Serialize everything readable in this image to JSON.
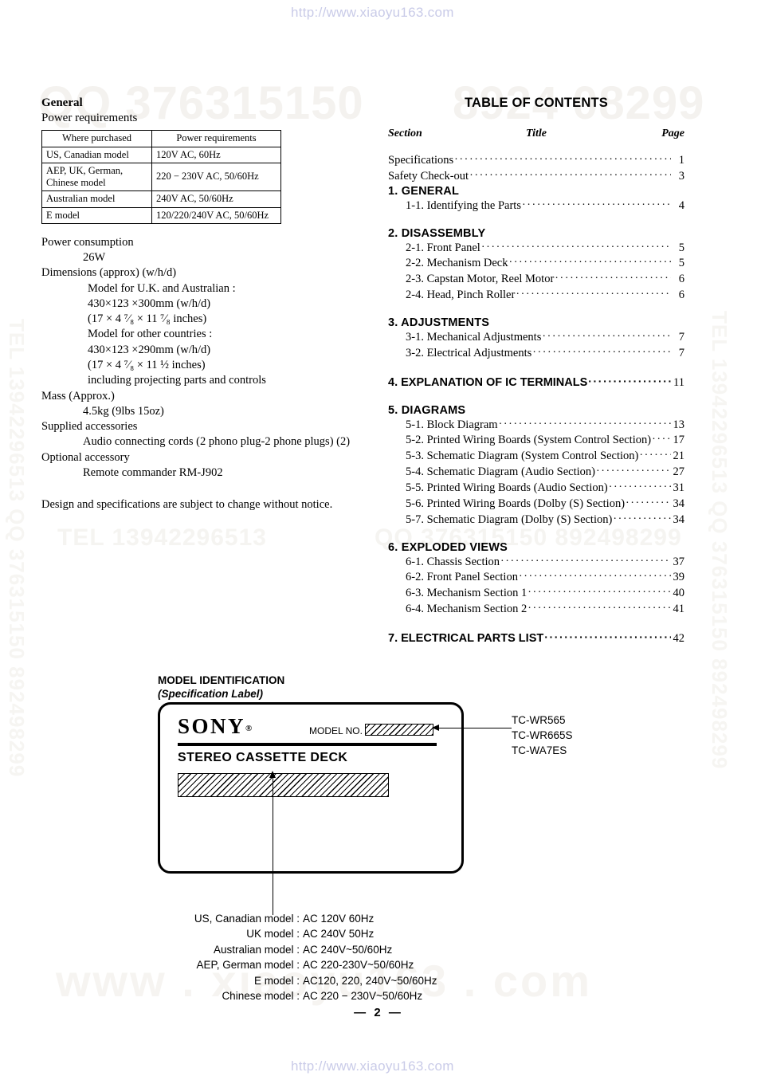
{
  "watermarks": {
    "top_url": "http://www.xiaoyu163.com",
    "bottom_url": "http://www.xiaoyu163.com",
    "qq_big": "QQ 376315150",
    "qq_big2": "8924 08299",
    "tel_mid": "TEL  13942296513",
    "qq_mid": "QQ 376315150   892498299",
    "vert_left": "TEL 13942296513 QQ 376315150 892498299",
    "vert_right": "TEL 13942296513 QQ 376315150 892498299",
    "site_big": "www . xiaoyu163 . com",
    "color_url": "#c9cbe8",
    "color_mark": "#f5f3f0"
  },
  "specifications": {
    "heading": "General",
    "subheading": "Power requirements",
    "table": {
      "headers": [
        "Where purchased",
        "Power requirements"
      ],
      "rows": [
        [
          "US, Canadian model",
          "120V AC, 60Hz"
        ],
        [
          "AEP, UK, German,\nChinese model",
          "220 − 230V AC, 50/60Hz"
        ],
        [
          "Australian model",
          "240V AC, 50/60Hz"
        ],
        [
          "E model",
          "120/220/240V  AC, 50/60Hz"
        ]
      ]
    },
    "lines": [
      {
        "indent": 0,
        "text": "Power consumption"
      },
      {
        "indent": 1,
        "text": "26W"
      },
      {
        "indent": 0,
        "text": "Dimensions (approx) (w/h/d)"
      },
      {
        "indent": 2,
        "text": "Model for U.K. and Australian :"
      },
      {
        "indent": 2,
        "text": "430×123 ×300mm (w/h/d)"
      },
      {
        "indent": 2,
        "text": "(17 × 4 ⁷⁄₈  × 11 ⁷⁄₈  inches)"
      },
      {
        "indent": 2,
        "text": "Model for other countries :"
      },
      {
        "indent": 2,
        "text": "430×123 ×290mm (w/h/d)"
      },
      {
        "indent": 2,
        "text": "(17 × 4 ⁷⁄₈  × 11 ½  inches)"
      },
      {
        "indent": 2,
        "text": "including projecting parts and controls"
      },
      {
        "indent": 0,
        "text": "Mass (Approx.)"
      },
      {
        "indent": 1,
        "text": "4.5kg (9lbs 15oz)"
      },
      {
        "indent": 0,
        "text": "Supplied accessories"
      },
      {
        "indent": 1,
        "text": "Audio connecting cords (2 phono plug-2 phone plugs) (2)"
      },
      {
        "indent": 0,
        "text": "Optional accessory"
      },
      {
        "indent": 1,
        "text": "Remote commander RM-J902"
      }
    ],
    "note": "Design and specifications are subject to change without notice."
  },
  "toc": {
    "heading": "TABLE OF CONTENTS",
    "columns": {
      "section": "Section",
      "title": "Title",
      "page": "Page"
    },
    "top_entries": [
      {
        "label": "Specifications",
        "page": "1"
      },
      {
        "label": "Safety Check-out",
        "page": "3"
      }
    ],
    "groups": [
      {
        "number": "1.",
        "title": "GENERAL",
        "page": "",
        "items": [
          {
            "label": "1-1. Identifying the Parts",
            "page": "4"
          }
        ]
      },
      {
        "number": "2.",
        "title": "DISASSEMBLY",
        "page": "",
        "items": [
          {
            "label": "2-1. Front Panel",
            "page": "5"
          },
          {
            "label": "2-2. Mechanism Deck",
            "page": "5"
          },
          {
            "label": "2-3. Capstan Motor, Reel Motor",
            "page": "6"
          },
          {
            "label": "2-4. Head, Pinch Roller",
            "page": "6"
          }
        ]
      },
      {
        "number": "3.",
        "title": "ADJUSTMENTS",
        "page": "",
        "items": [
          {
            "label": "3-1. Mechanical Adjustments",
            "page": "7"
          },
          {
            "label": "3-2. Electrical Adjustments",
            "page": "7"
          }
        ]
      },
      {
        "number": "4.",
        "title": "EXPLANATION OF IC TERMINALS",
        "page": "11",
        "items": []
      },
      {
        "number": "5.",
        "title": "DIAGRAMS",
        "page": "",
        "items": [
          {
            "label": "5-1. Block Diagram",
            "page": "13"
          },
          {
            "label": "5-2. Printed Wiring Boards (System Control Section)",
            "page": "17"
          },
          {
            "label": "5-3. Schematic Diagram  (System Control Section)",
            "page": "21"
          },
          {
            "label": "5-4. Schematic Diagram (Audio Section)",
            "page": "27"
          },
          {
            "label": "5-5. Printed Wiring Boards (Audio Section)",
            "page": "31"
          },
          {
            "label": "5-6. Printed Wiring Boards (Dolby (S) Section)",
            "page": "34"
          },
          {
            "label": "5-7. Schematic Diagram (Dolby (S) Section)",
            "page": "34"
          }
        ]
      },
      {
        "number": "6.",
        "title": "EXPLODED VIEWS",
        "page": "",
        "items": [
          {
            "label": "6-1. Chassis Section",
            "page": "37"
          },
          {
            "label": "6-2. Front Panel Section",
            "page": "39"
          },
          {
            "label": "6-3. Mechanism Section 1",
            "page": "40"
          },
          {
            "label": "6-4. Mechanism Section 2",
            "page": "41"
          }
        ]
      },
      {
        "number": "7.",
        "title": "ELECTRICAL PARTS LIST",
        "page": "42",
        "items": []
      }
    ]
  },
  "model_identification": {
    "title": "MODEL IDENTIFICATION",
    "subtitle": "(Specification Label)",
    "label": {
      "brand": "SONY",
      "registered": "®",
      "model_no_caption": "MODEL NO.",
      "product_name": "STEREO CASSETTE DECK"
    },
    "model_numbers": [
      "TC-WR565",
      "TC-WR665S",
      "TC-WA7ES"
    ],
    "voltage_rows": [
      {
        "key": "US, Canadian model :",
        "value": "AC 120V 60Hz"
      },
      {
        "key": "UK model :",
        "value": "AC 240V 50Hz"
      },
      {
        "key": "Australian model :",
        "value": "AC 240V~50/60Hz"
      },
      {
        "key": "AEP, German model :",
        "value": "AC 220-230V~50/60Hz"
      },
      {
        "key": "E model :",
        "value": "AC120, 220, 240V~50/60Hz"
      },
      {
        "key": "Chinese model :",
        "value": "AC 220 − 230V~50/60Hz"
      }
    ]
  },
  "footer": {
    "page_number": "—  2  —"
  }
}
